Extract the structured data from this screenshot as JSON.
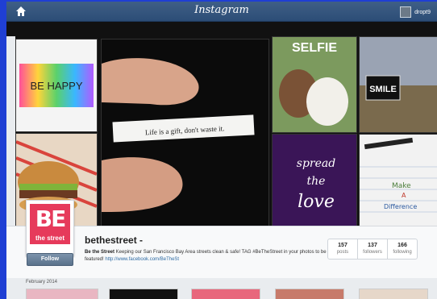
{
  "app": {
    "title": "Instagram"
  },
  "topbar": {
    "username": "dropt9",
    "home_icon": "home-icon"
  },
  "grid_texts": {
    "be_happy": "BE HAPPY",
    "fortune": "Life is a gift, don't waste it.",
    "selfie": "SELFIE",
    "smile": "SMILE",
    "spread_love": [
      "spread",
      "the",
      "love"
    ],
    "make_difference": [
      "Make",
      "A",
      "Difference"
    ]
  },
  "profile": {
    "avatar_top": "BE",
    "avatar_bottom": "the street",
    "username": "bethestreet -",
    "follow_label": "Follow",
    "bio_name": "Be the Street",
    "bio_text": " Keeping our San Francisco Bay Area streets clean & safe! TAG #BeTheStreet in your photos to be featured! ",
    "bio_link": "http://www.facebook.com/BeTheSt",
    "stats": [
      {
        "value": "157",
        "label": "posts"
      },
      {
        "value": "137",
        "label": "followers"
      },
      {
        "value": "166",
        "label": "following"
      }
    ]
  },
  "feed": {
    "month_label": "February 2014"
  },
  "colors": {
    "topbar": "#2c4d76",
    "follow_button": "#6a829b",
    "avatar_bg": "#e63a5b",
    "link": "#2d6aa3"
  }
}
